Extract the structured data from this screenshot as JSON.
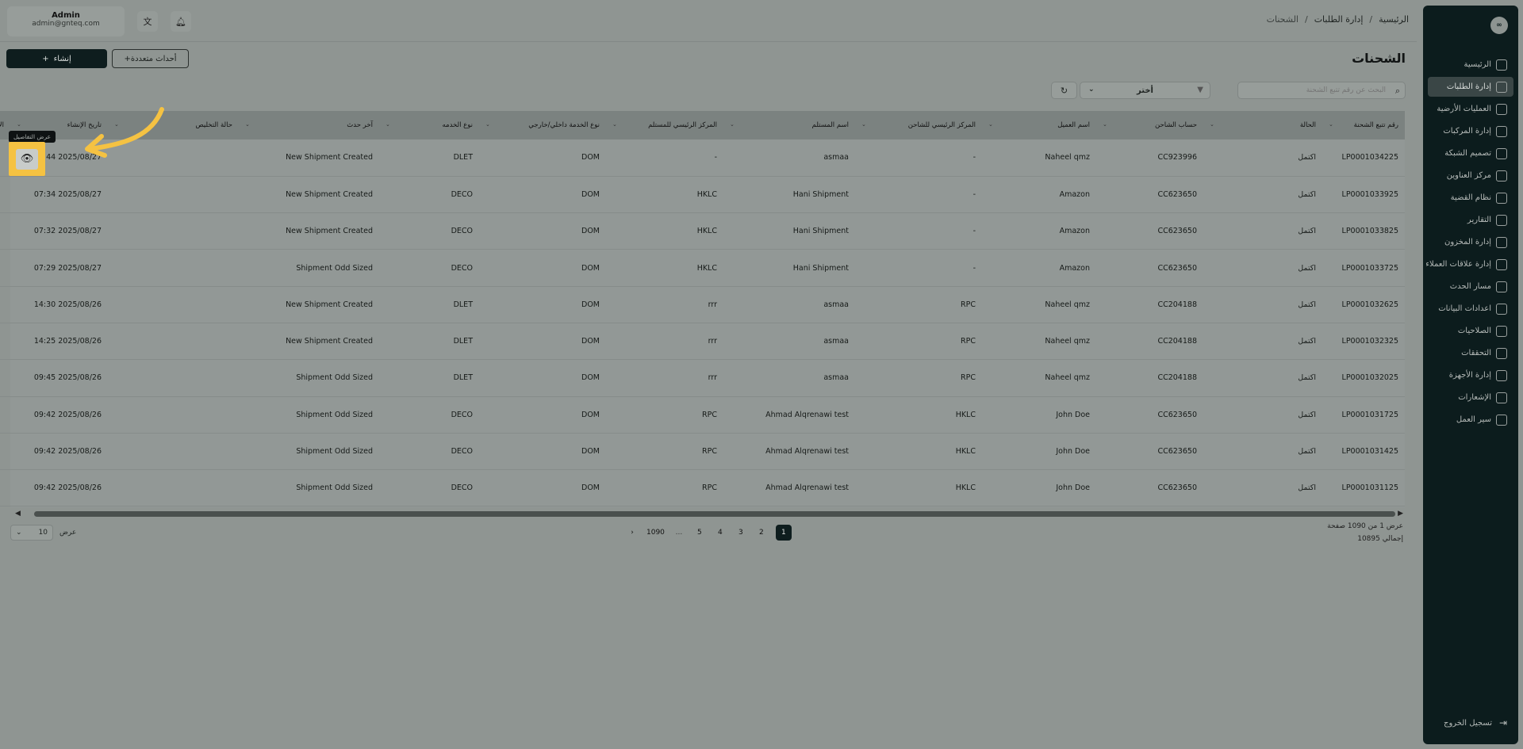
{
  "sidebar": {
    "logo": "∞",
    "items": [
      {
        "label": "الرئيسية",
        "icon": "home-icon"
      },
      {
        "label": "إدارة الطلبات",
        "icon": "orders-icon",
        "active": true
      },
      {
        "label": "العمليات الأرضية",
        "icon": "ground-ops-icon"
      },
      {
        "label": "إدارة المركبات",
        "icon": "truck-icon"
      },
      {
        "label": "تصميم الشبكة",
        "icon": "network-icon"
      },
      {
        "label": "مركز العناوين",
        "icon": "address-icon"
      },
      {
        "label": "نظام القضية",
        "icon": "case-icon"
      },
      {
        "label": "التقارير",
        "icon": "reports-icon"
      },
      {
        "label": "إدارة المخزون",
        "icon": "inventory-icon"
      },
      {
        "label": "إدارة علاقات العملاء",
        "icon": "crm-icon"
      },
      {
        "label": "مسار الحدث",
        "icon": "event-path-icon"
      },
      {
        "label": "اعدادات البيانات",
        "icon": "database-icon"
      },
      {
        "label": "الصلاحيات",
        "icon": "users-icon"
      },
      {
        "label": "التحققات",
        "icon": "validation-icon"
      },
      {
        "label": "إدارة الأجهزة",
        "icon": "devices-icon"
      },
      {
        "label": "الإشعارات",
        "icon": "bell-icon"
      },
      {
        "label": "سير العمل",
        "icon": "workflow-icon"
      }
    ],
    "logout": "تسجيل الخروج"
  },
  "header": {
    "breadcrumb": [
      "الرئيسية",
      "إدارة الطلبات",
      "الشحنات"
    ],
    "user_name": "Admin",
    "user_email": "admin@gnteq.com"
  },
  "page": {
    "title": "الشحنات",
    "create_label": "إنشاء",
    "multi_events_label": "أحداث متعددة+",
    "search_placeholder": "البحث عن رقم تتبع الشحنة",
    "filter_label": "أختر"
  },
  "table": {
    "columns": [
      "رقم تتبع الشحنة",
      "الحالة",
      "حساب الشاحن",
      "اسم العميل",
      "المركز الرئيسي للشاحن",
      "اسم المستلم",
      "المركز الرئيسي للمستلم",
      "نوع الخدمة داخلي/خارجي",
      "نوع الخدمه",
      "آخر حدث",
      "حالة التخليص",
      "تاريخ الإنشاء",
      "الإجراءات"
    ],
    "rows": [
      [
        "LP0001034225",
        "اكتمل",
        "CC923996",
        "Naheel qmz",
        "-",
        "asmaa",
        "-",
        "DOM",
        "DLET",
        "New Shipment Created",
        "",
        "07:44 2025/08/27"
      ],
      [
        "LP0001033925",
        "اكتمل",
        "CC623650",
        "Amazon",
        "-",
        "Hani Shipment",
        "HKLC",
        "DOM",
        "DECO",
        "New Shipment Created",
        "",
        "07:34 2025/08/27"
      ],
      [
        "LP0001033825",
        "اكتمل",
        "CC623650",
        "Amazon",
        "-",
        "Hani Shipment",
        "HKLC",
        "DOM",
        "DECO",
        "New Shipment Created",
        "",
        "07:32 2025/08/27"
      ],
      [
        "LP0001033725",
        "اكتمل",
        "CC623650",
        "Amazon",
        "-",
        "Hani Shipment",
        "HKLC",
        "DOM",
        "DECO",
        "Shipment Odd Sized",
        "",
        "07:29 2025/08/27"
      ],
      [
        "LP0001032625",
        "اكتمل",
        "CC204188",
        "Naheel qmz",
        "RPC",
        "asmaa",
        "rrr",
        "DOM",
        "DLET",
        "New Shipment Created",
        "",
        "14:30 2025/08/26"
      ],
      [
        "LP0001032325",
        "اكتمل",
        "CC204188",
        "Naheel qmz",
        "RPC",
        "asmaa",
        "rrr",
        "DOM",
        "DLET",
        "New Shipment Created",
        "",
        "14:25 2025/08/26"
      ],
      [
        "LP0001032025",
        "اكتمل",
        "CC204188",
        "Naheel qmz",
        "RPC",
        "asmaa",
        "rrr",
        "DOM",
        "DLET",
        "Shipment Odd Sized",
        "",
        "09:45 2025/08/26"
      ],
      [
        "LP0001031725",
        "اكتمل",
        "CC623650",
        "John Doe",
        "HKLC",
        "Ahmad Alqrenawi test",
        "RPC",
        "DOM",
        "DECO",
        "Shipment Odd Sized",
        "",
        "09:42 2025/08/26"
      ],
      [
        "LP0001031425",
        "اكتمل",
        "CC623650",
        "John Doe",
        "HKLC",
        "Ahmad Alqrenawi test",
        "RPC",
        "DOM",
        "DECO",
        "Shipment Odd Sized",
        "",
        "09:42 2025/08/26"
      ],
      [
        "LP0001031125",
        "اكتمل",
        "CC623650",
        "John Doe",
        "HKLC",
        "Ahmad Alqrenawi test",
        "RPC",
        "DOM",
        "DECO",
        "Shipment Odd Sized",
        "",
        "09:42 2025/08/26"
      ]
    ]
  },
  "pagination": {
    "pages": [
      "1",
      "2",
      "3",
      "4",
      "5",
      "...",
      "1090"
    ],
    "active": "1",
    "info_line1": "عرض 1 من 1090 صفحة",
    "info_line2": "إجمالي 10895",
    "per_page_label": "عرض",
    "per_page_value": "10"
  },
  "annotation": {
    "tooltip": "عرض التفاصيل",
    "highlight_color": "#f5c242"
  }
}
